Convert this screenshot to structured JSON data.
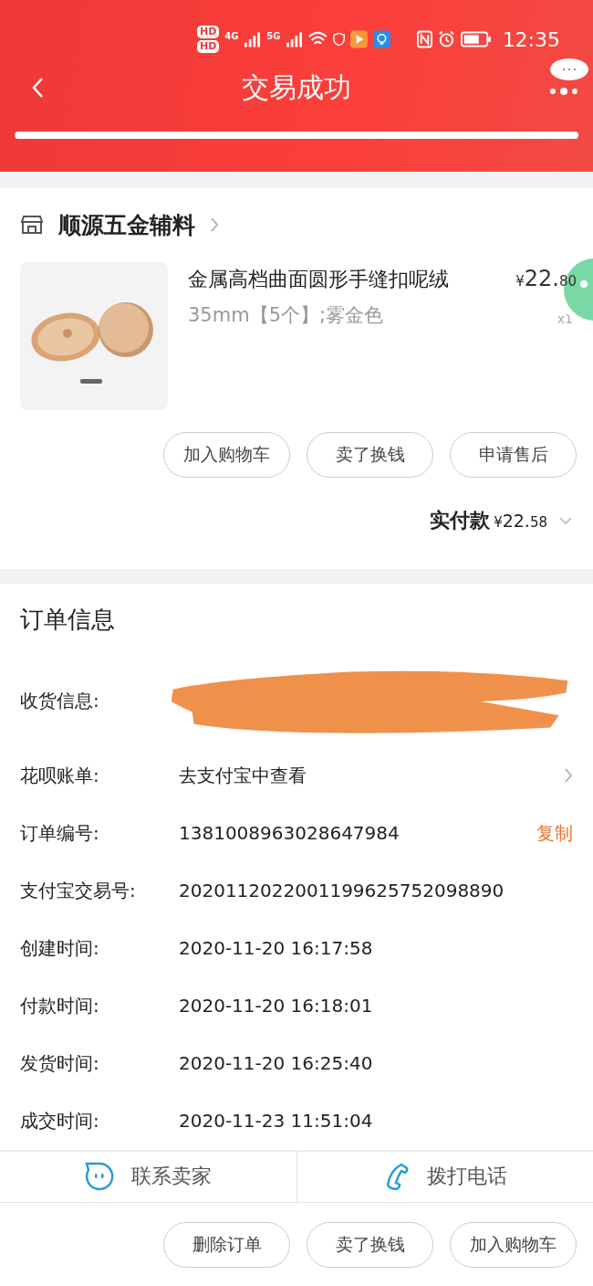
{
  "status_bar": {
    "time": "12:35",
    "sim_labels": [
      "HD",
      "HD"
    ],
    "network_labels": [
      "4G",
      "5G"
    ]
  },
  "nav": {
    "title": "交易成功"
  },
  "store": {
    "name": "顺源五金辅料",
    "item": {
      "title": "金属高档曲面圆形手缝扣呢绒",
      "spec": "35mm【5个】;雾金色",
      "currency": "¥",
      "price_int": "22.",
      "price_dec": "80",
      "quantity": "x1"
    },
    "item_buttons": [
      "加入购物车",
      "卖了换钱",
      "申请售后"
    ],
    "paid": {
      "label": "实付款",
      "currency": "¥",
      "amount_int": "22.",
      "amount_dec": "58"
    }
  },
  "order_info": {
    "title": "订单信息",
    "rows": [
      {
        "kind": "redacted",
        "label": "收货信息:"
      },
      {
        "kind": "link",
        "label": "花呗账单:",
        "value": "去支付宝中查看"
      },
      {
        "kind": "copy",
        "label": "订单编号:",
        "value": "1381008963028647984",
        "action": "复制"
      },
      {
        "kind": "plain",
        "label": "支付宝交易号:",
        "value": "2020112022001199625752098890"
      },
      {
        "kind": "plain",
        "label": "创建时间:",
        "value": "2020-11-20 16:17:58"
      },
      {
        "kind": "plain",
        "label": "付款时间:",
        "value": "2020-11-20 16:18:01"
      },
      {
        "kind": "plain",
        "label": "发货时间:",
        "value": "2020-11-20 16:25:40"
      },
      {
        "kind": "plain",
        "label": "成交时间:",
        "value": "2020-11-23 11:51:04"
      }
    ]
  },
  "contact_bar": [
    {
      "kind": "chat",
      "label": "联系卖家"
    },
    {
      "kind": "phone",
      "label": "拨打电话"
    }
  ],
  "bottom_buttons": [
    "删除订单",
    "卖了换钱",
    "加入购物车"
  ]
}
